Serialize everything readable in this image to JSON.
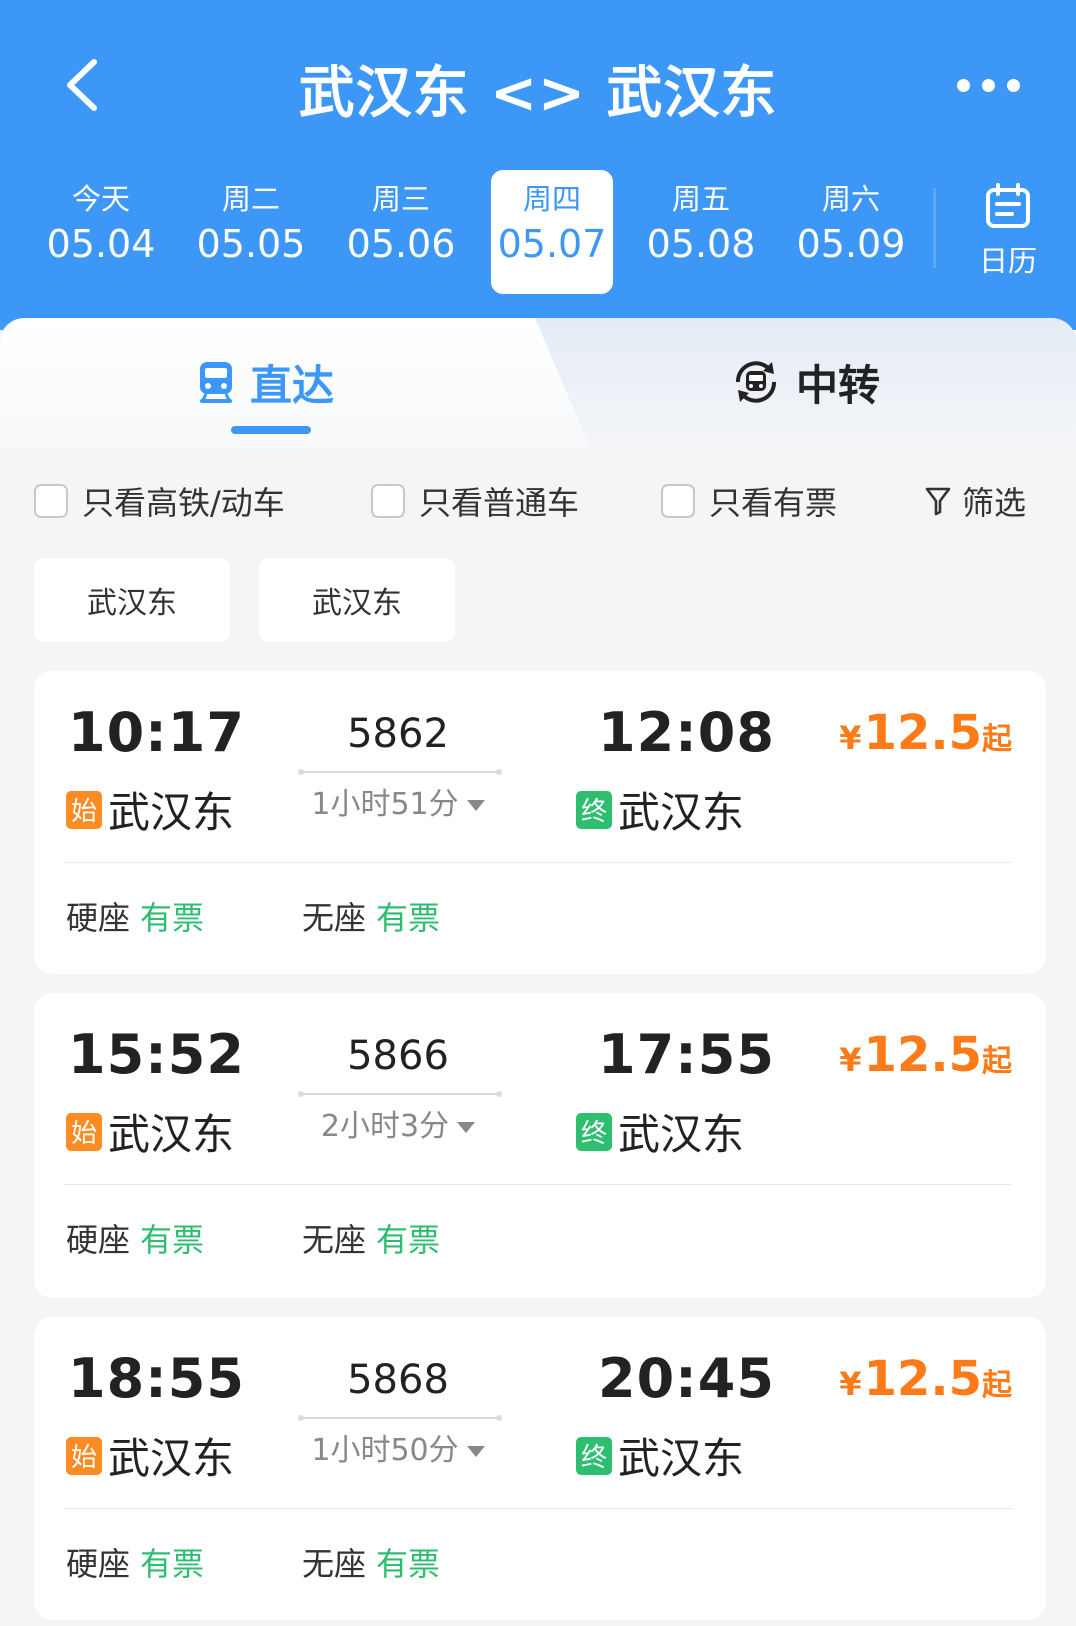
{
  "header": {
    "title": "武汉东 <> 武汉东",
    "back_icon": "chevron-left-icon",
    "more_icon": "more-dots-icon"
  },
  "dates": [
    {
      "weekday": "今天",
      "date": "05.04",
      "active": false
    },
    {
      "weekday": "周二",
      "date": "05.05",
      "active": false
    },
    {
      "weekday": "周三",
      "date": "05.06",
      "active": false
    },
    {
      "weekday": "周四",
      "date": "05.07",
      "active": true
    },
    {
      "weekday": "周五",
      "date": "05.08",
      "active": false
    },
    {
      "weekday": "周六",
      "date": "05.09",
      "active": false
    }
  ],
  "calendar": {
    "label": "日历",
    "icon": "calendar-icon"
  },
  "tabs": [
    {
      "label": "直达",
      "icon": "train-icon",
      "active": true
    },
    {
      "label": "中转",
      "icon": "transfer-train-icon",
      "active": false
    }
  ],
  "filters": [
    {
      "label": "只看高铁/动车",
      "checked": false
    },
    {
      "label": "只看普通车",
      "checked": false
    },
    {
      "label": "只看有票",
      "checked": false
    }
  ],
  "filter_button": {
    "label": "筛选",
    "icon": "filter-icon"
  },
  "station_chips": [
    "武汉东",
    "武汉东"
  ],
  "trains": [
    {
      "dep_time": "10:17",
      "dep_station": "武汉东",
      "dep_tag": "始",
      "train_no": "5862",
      "duration": "1小时51分",
      "arr_time": "12:08",
      "arr_station": "武汉东",
      "arr_tag": "终",
      "price_symbol": "¥",
      "price": "12.5",
      "price_suffix": "起",
      "seats": [
        {
          "name": "硬座",
          "status": "有票"
        },
        {
          "name": "无座",
          "status": "有票"
        }
      ]
    },
    {
      "dep_time": "15:52",
      "dep_station": "武汉东",
      "dep_tag": "始",
      "train_no": "5866",
      "duration": "2小时3分",
      "arr_time": "17:55",
      "arr_station": "武汉东",
      "arr_tag": "终",
      "price_symbol": "¥",
      "price": "12.5",
      "price_suffix": "起",
      "seats": [
        {
          "name": "硬座",
          "status": "有票"
        },
        {
          "name": "无座",
          "status": "有票"
        }
      ]
    },
    {
      "dep_time": "18:55",
      "dep_station": "武汉东",
      "dep_tag": "始",
      "train_no": "5868",
      "duration": "1小时50分",
      "arr_time": "20:45",
      "arr_station": "武汉东",
      "arr_tag": "终",
      "price_symbol": "¥",
      "price": "12.5",
      "price_suffix": "起",
      "seats": [
        {
          "name": "硬座",
          "status": "有票"
        },
        {
          "name": "无座",
          "status": "有票"
        }
      ]
    }
  ],
  "colors": {
    "primary": "#3d97f6",
    "price": "#fd7a19",
    "available": "#2ebe70",
    "start_tag": "#fd8b24",
    "end_tag": "#2ebe70"
  }
}
